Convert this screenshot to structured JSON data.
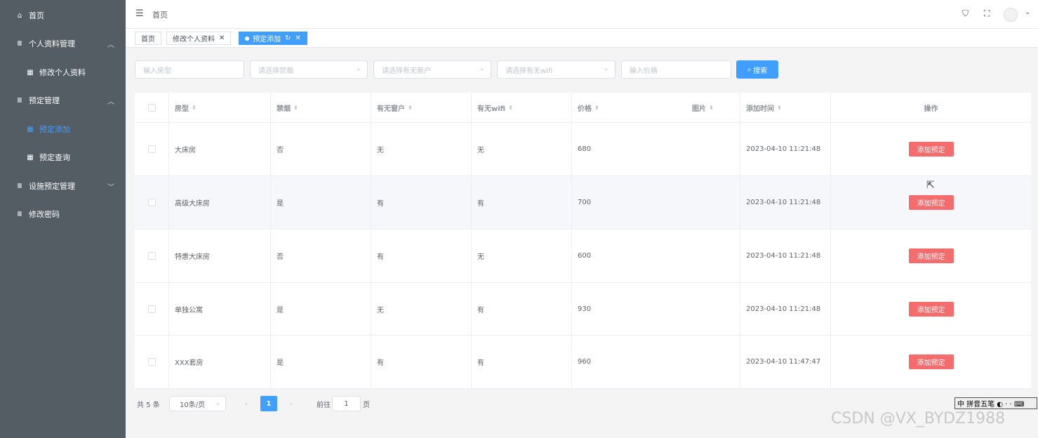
{
  "sidebar": {
    "items": [
      {
        "label": "首页",
        "icon": "home-icon",
        "glyph": "⌂",
        "arrow": ""
      },
      {
        "label": "个人资料管理",
        "icon": "menu-icon",
        "glyph": "Ⅲ",
        "arrow": "︿"
      },
      {
        "label": "修改个人资料",
        "icon": "grid-icon",
        "glyph": "▦",
        "arrow": ""
      },
      {
        "label": "预定管理",
        "icon": "menu-icon",
        "glyph": "Ⅲ",
        "arrow": "︿"
      },
      {
        "label": "预定添加",
        "icon": "grid-icon",
        "glyph": "▦",
        "arrow": ""
      },
      {
        "label": "预定查询",
        "icon": "grid-icon",
        "glyph": "▦",
        "arrow": ""
      },
      {
        "label": "设施预定管理",
        "icon": "menu-icon",
        "glyph": "Ⅲ",
        "arrow": "﹀"
      },
      {
        "label": "修改密码",
        "icon": "menu-icon",
        "glyph": "Ⅲ",
        "arrow": ""
      }
    ]
  },
  "header": {
    "title": "首页",
    "hamburger_glyph": "☰",
    "shirt_glyph": "⛉",
    "fullscreen_glyph": "⛶",
    "caret_glyph": "⌄"
  },
  "tags": {
    "items": [
      {
        "label": "首页",
        "close": ""
      },
      {
        "label": "修改个人资料",
        "close": "✕"
      },
      {
        "label": "预定添加",
        "close": "✕",
        "refresh": "↻"
      }
    ]
  },
  "filters": {
    "room_type_placeholder": "输入房型",
    "smoking_placeholder": "请选择禁烟",
    "window_placeholder": "请选择有无窗户",
    "wifi_placeholder": "请选择有无wifi",
    "price_placeholder": "输入价格",
    "search_label": "搜索",
    "search_glyph": "⌕",
    "down_glyph": "⌄"
  },
  "table": {
    "columns": [
      "房型",
      "禁烟",
      "有无窗户",
      "有无wifi",
      "价格",
      "图片",
      "添加时间",
      "操作"
    ],
    "sort_glyph": "⬍",
    "rows": [
      {
        "room": "大床房",
        "smoking": "否",
        "window": "无",
        "wifi": "无",
        "price": "680",
        "image": "",
        "time": "2023-04-10 11:21:48",
        "action": "添加预定"
      },
      {
        "room": "高级大床房",
        "smoking": "是",
        "window": "有",
        "wifi": "有",
        "price": "700",
        "image": "",
        "time": "2023-04-10 11:21:48",
        "action": "添加预定"
      },
      {
        "room": "特惠大床房",
        "smoking": "否",
        "window": "有",
        "wifi": "无",
        "price": "600",
        "image": "",
        "time": "2023-04-10 11:21:48",
        "action": "添加预定"
      },
      {
        "room": "单独公寓",
        "smoking": "是",
        "window": "无",
        "wifi": "有",
        "price": "930",
        "image": "",
        "time": "2023-04-10 11:21:48",
        "action": "添加预定"
      },
      {
        "room": "XXX套房",
        "smoking": "是",
        "window": "有",
        "wifi": "有",
        "price": "960",
        "image": "",
        "time": "2023-04-10 11:47:47",
        "action": "添加预定"
      }
    ]
  },
  "pagination": {
    "total": "共 5 条",
    "page_size": "10条/页",
    "prev": "‹",
    "current": "1",
    "next": "›",
    "goto_prefix": "前往",
    "goto_value": "1",
    "goto_suffix": "页"
  },
  "ime_bar": "中 拼音五笔 ◐ · · ⌨",
  "watermark": "CSDN @VX_BYDZ1988",
  "cursor_glyph": "⇱"
}
